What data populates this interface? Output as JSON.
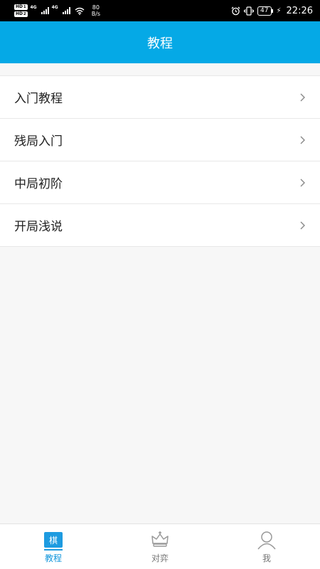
{
  "status_bar": {
    "hd1": "HD",
    "hd1_sub": "1",
    "hd2": "HD",
    "hd2_sub": "2",
    "net1": "4G",
    "net2": "4G",
    "speed_value": "80",
    "speed_unit": "B/s",
    "battery": "47",
    "time": "22:26"
  },
  "header": {
    "title": "教程"
  },
  "menu": {
    "items": [
      {
        "label": "入门教程"
      },
      {
        "label": "残局入门"
      },
      {
        "label": "中局初阶"
      },
      {
        "label": "开局浅说"
      }
    ]
  },
  "tabs": [
    {
      "label": "教程",
      "icon": "chess-piece-qi-icon",
      "glyph": "棋",
      "active": true
    },
    {
      "label": "对弈",
      "icon": "crown-icon",
      "active": false
    },
    {
      "label": "我",
      "icon": "user-icon",
      "active": false
    }
  ],
  "colors": {
    "accent": "#05a9e6",
    "tab_active": "#1296db"
  }
}
